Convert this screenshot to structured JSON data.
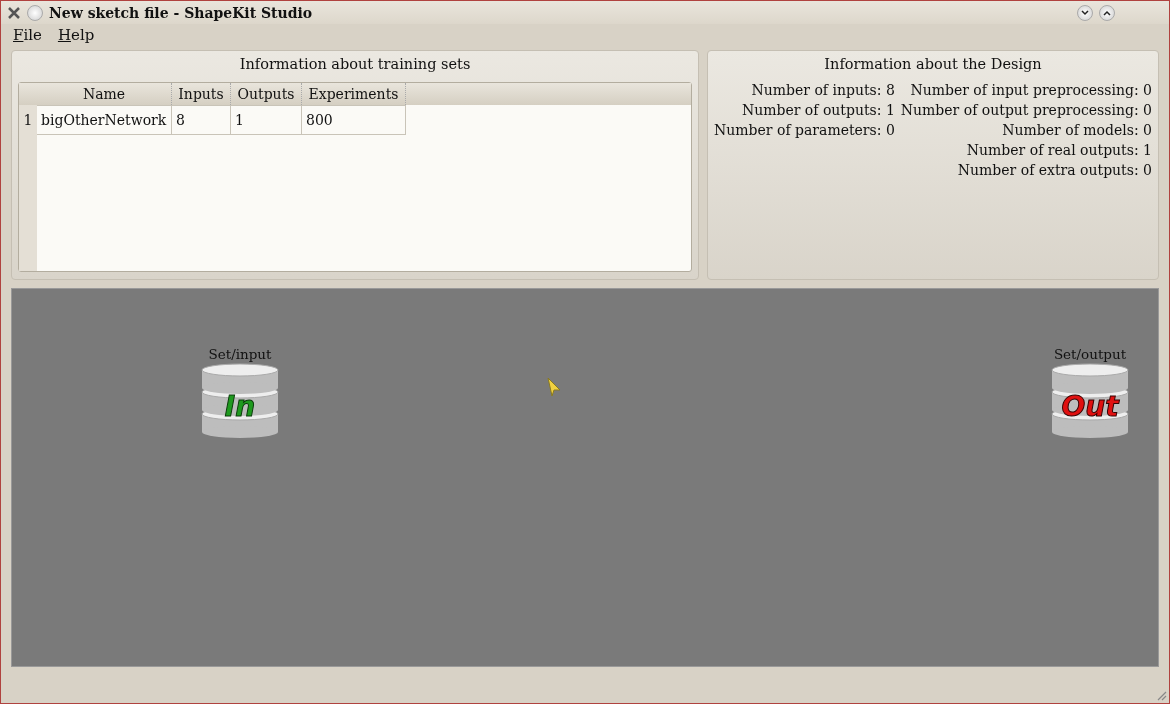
{
  "window": {
    "title": "New sketch file - ShapeKit Studio"
  },
  "menu": [
    {
      "label": "File"
    },
    {
      "label": "Help"
    }
  ],
  "training_sets": {
    "title": "Information about training sets",
    "columns": [
      "Name",
      "Inputs",
      "Outputs",
      "Experiments"
    ],
    "rows": [
      {
        "index": "1",
        "cells": [
          "bigOtherNetwork",
          "8",
          "1",
          "800"
        ]
      }
    ]
  },
  "design": {
    "title": "Information about the Design",
    "left": [
      "Number of inputs: 8",
      "Number of outputs: 1",
      "Number of parameters: 0"
    ],
    "right": [
      "Number of input preprocessing: 0",
      "Number of output preprocessing: 0",
      "Number of models: 0",
      "Number of real outputs: 1",
      "Number of extra outputs: 0"
    ]
  },
  "canvas": {
    "nodes": [
      {
        "kind": "input",
        "label": "Set/input",
        "badge": "In"
      },
      {
        "kind": "output",
        "label": "Set/output",
        "badge": "Out"
      }
    ]
  }
}
